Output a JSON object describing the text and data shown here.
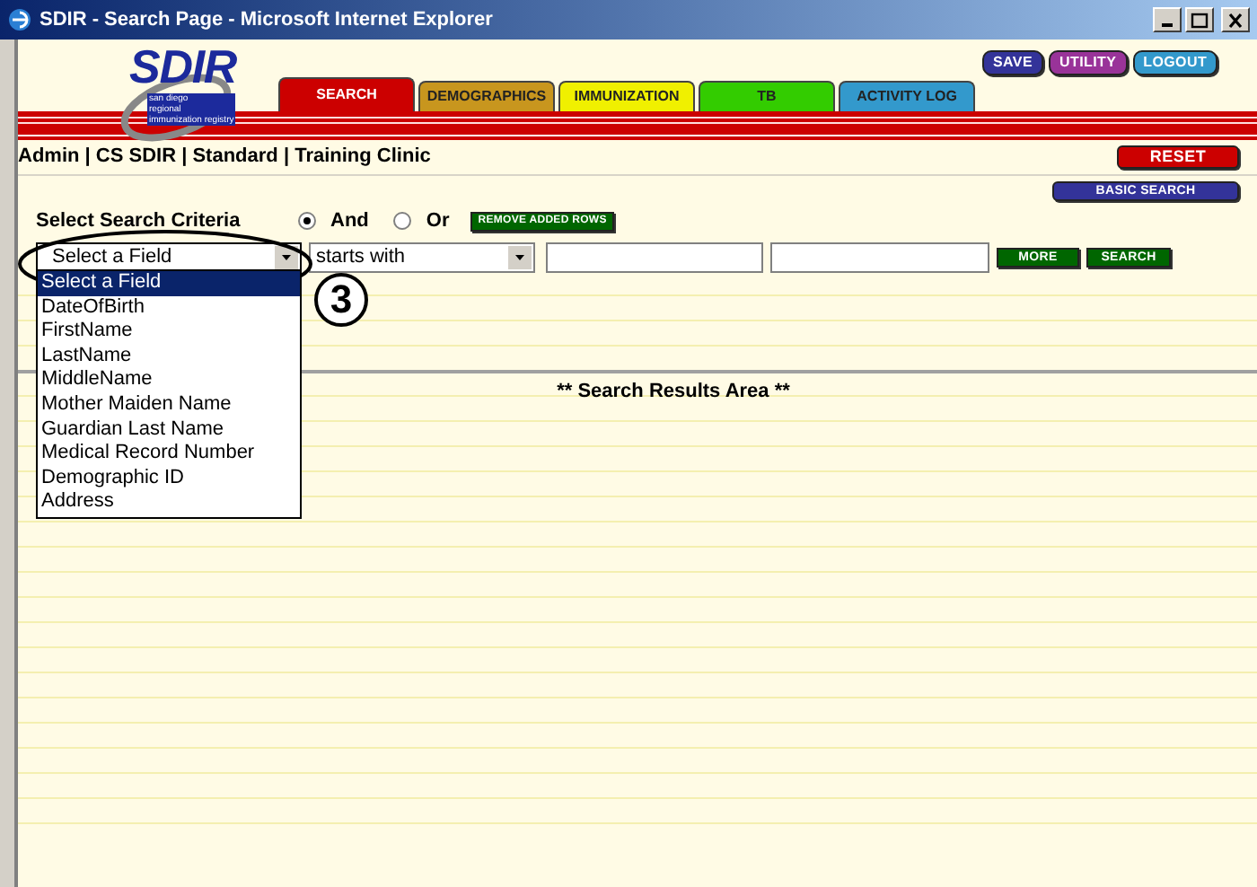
{
  "window": {
    "title": "SDIR - Search Page - Microsoft Internet Explorer"
  },
  "logo": {
    "text": "SDIR",
    "tagline": [
      "san diego",
      "regional",
      "immunization registry"
    ]
  },
  "tabs": [
    {
      "label": "SEARCH",
      "color": "#cc0000",
      "selected": true
    },
    {
      "label": "DEMOGRAPHICS",
      "color": "#c8961e",
      "selected": false
    },
    {
      "label": "IMMUNIZATION",
      "color": "#f0f000",
      "selected": false
    },
    {
      "label": "TB",
      "color": "#33cc00",
      "selected": false
    },
    {
      "label": "ACTIVITY LOG",
      "color": "#3399cc",
      "selected": false
    }
  ],
  "nav_buttons": [
    {
      "label": "SAVE",
      "color": "#333399"
    },
    {
      "label": "UTILITY",
      "color": "#993399"
    },
    {
      "label": "LOGOUT",
      "color": "#3399cc"
    }
  ],
  "user_info": "Admin | CS SDIR | Standard | Training Clinic",
  "reset_button": "RESET",
  "basic_search_button": "BASIC SEARCH",
  "criteria_label": "Select Search Criteria",
  "logic": [
    {
      "label": "And",
      "selected": true
    },
    {
      "label": "Or",
      "selected": false
    }
  ],
  "remove_rows_button": "REMOVE ADDED ROWS",
  "field_select": {
    "value": "Select a Field",
    "expanded": true,
    "options": [
      {
        "label": "Select a Field",
        "selected": true
      },
      {
        "label": "DateOfBirth",
        "selected": false
      },
      {
        "label": "FirstName",
        "selected": false
      },
      {
        "label": "LastName",
        "selected": false
      },
      {
        "label": "MiddleName",
        "selected": false
      },
      {
        "label": "Mother Maiden Name",
        "selected": false
      },
      {
        "label": "Guardian Last Name",
        "selected": false
      },
      {
        "label": "Medical Record Number",
        "selected": false
      },
      {
        "label": "Demographic ID",
        "selected": false
      },
      {
        "label": "Address",
        "selected": false
      }
    ]
  },
  "operator_select": {
    "value": "starts with"
  },
  "more_button": "MORE",
  "search_button": "SEARCH",
  "results_heading": "** Search Results Area **",
  "annotation": "3"
}
